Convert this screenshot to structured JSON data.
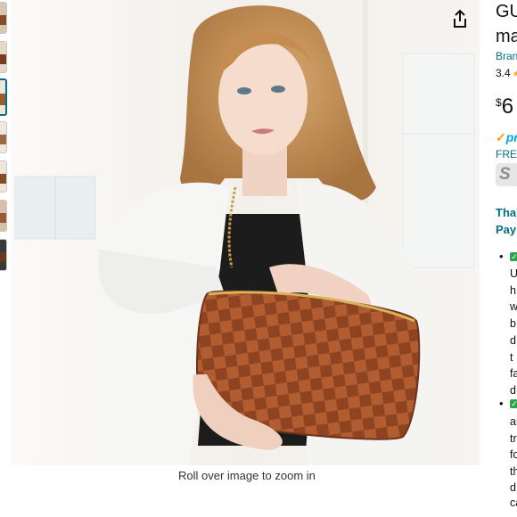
{
  "gallery": {
    "zoom_hint": "Roll over image to zoom in",
    "thumbnails": [
      {
        "label": "thumbnail-1",
        "colors": [
          "#d9c6b1",
          "#8a4a27"
        ]
      },
      {
        "label": "thumbnail-2",
        "colors": [
          "#e8d8c8",
          "#7a3c1c"
        ]
      },
      {
        "label": "thumbnail-3",
        "colors": [
          "#efe5db",
          "#a05a30"
        ]
      },
      {
        "label": "thumbnail-4",
        "colors": [
          "#efe8de",
          "#a06a40"
        ]
      },
      {
        "label": "thumbnail-5",
        "colors": [
          "#f0e6d8",
          "#8a4a27"
        ]
      },
      {
        "label": "thumbnail-6",
        "colors": [
          "#d8c0a8",
          "#9a5a35"
        ]
      },
      {
        "label": "thumbnail-7",
        "colors": [
          "#3a3a3a",
          "#6a3a20"
        ]
      }
    ]
  },
  "product": {
    "title_line1": "GU",
    "title_line2": "ma",
    "brand": "Bran",
    "rating": "3.4",
    "price_symbol": "$",
    "price_whole": "6",
    "prime": "pr",
    "free": "FREE",
    "save_label": "S",
    "thanks_line1": "Than",
    "thanks_line2": "Pay "
  },
  "bullets": [
    {
      "fragments": [
        "U",
        "h",
        "w",
        "b",
        "d",
        "t",
        "fa",
        "d"
      ]
    },
    {
      "fragments": [
        "al",
        "tr",
        "fo",
        "th",
        "d",
        "ca",
        "d"
      ]
    }
  ],
  "colors": {
    "link": "#007185",
    "text": "#0F1111",
    "prime": "#00A8E1",
    "star": "#FFA41C",
    "check": "#2ea44f"
  }
}
